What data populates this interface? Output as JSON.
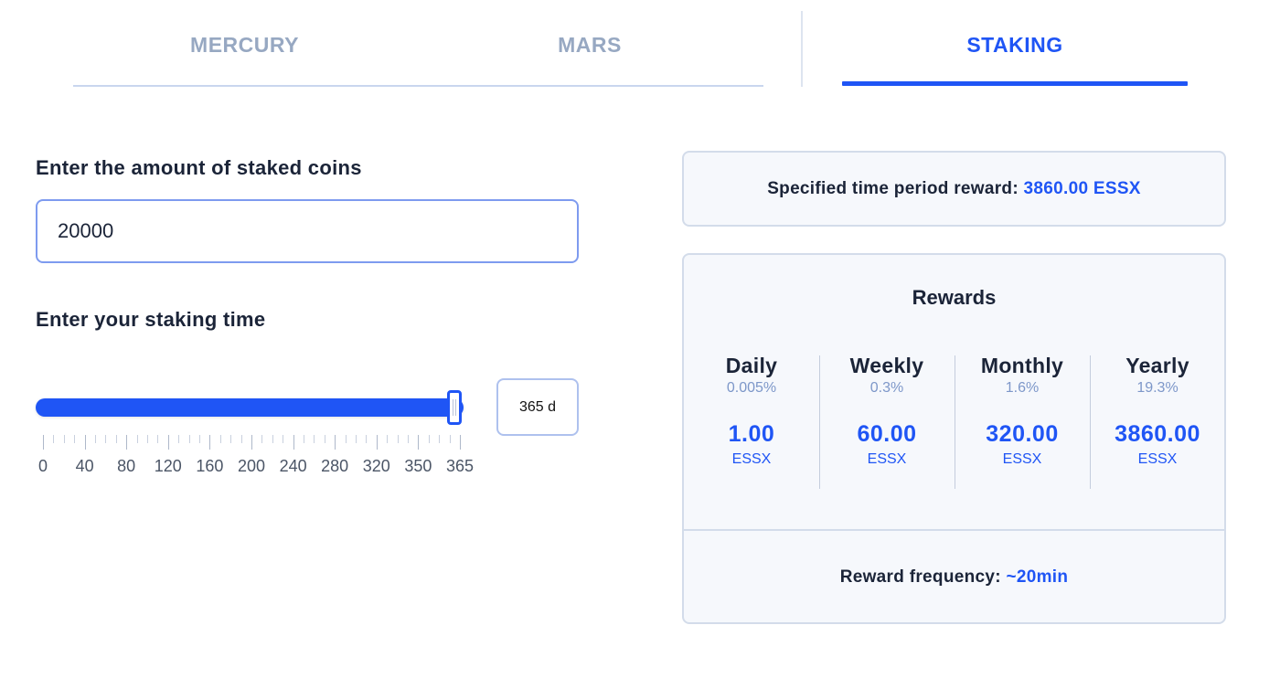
{
  "tabs": {
    "mercury": "MERCURY",
    "mars": "MARS",
    "staking": "STAKING"
  },
  "form": {
    "amount_label": "Enter the amount of staked coins",
    "amount_value": "20000",
    "time_label": "Enter your staking time",
    "slider": {
      "min": 0,
      "max": 365,
      "value": 365,
      "tick_labels": [
        "0",
        "40",
        "80",
        "120",
        "160",
        "200",
        "240",
        "280",
        "320",
        "350",
        "365"
      ]
    },
    "days_display": "365 d"
  },
  "summary": {
    "label": "Specified time period reward: ",
    "value": "3860.00 ESSX"
  },
  "rewards": {
    "title": "Rewards",
    "columns": [
      {
        "name": "Daily",
        "percent": "0.005%",
        "amount": "1.00",
        "unit": "ESSX"
      },
      {
        "name": "Weekly",
        "percent": "0.3%",
        "amount": "60.00",
        "unit": "ESSX"
      },
      {
        "name": "Monthly",
        "percent": "1.6%",
        "amount": "320.00",
        "unit": "ESSX"
      },
      {
        "name": "Yearly",
        "percent": "19.3%",
        "amount": "3860.00",
        "unit": "ESSX"
      }
    ],
    "frequency_label": "Reward frequency: ",
    "frequency_value": "~20min"
  },
  "colors": {
    "accent": "#1f55f5",
    "tab_inactive": "#97a8c2",
    "text": "#1b2438",
    "card_bg": "#f6f8fc"
  }
}
